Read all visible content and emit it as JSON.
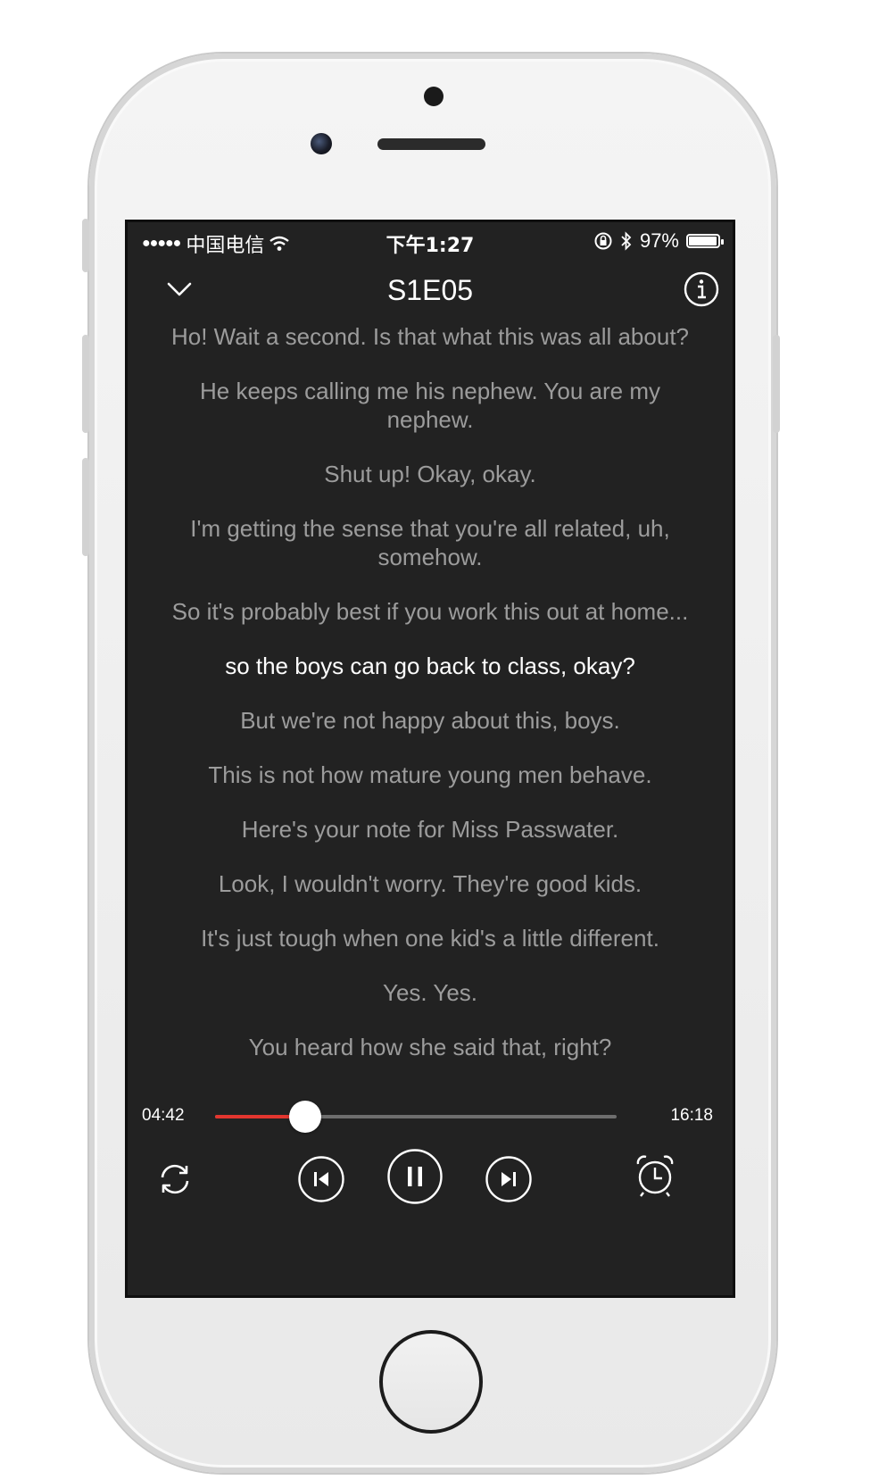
{
  "status_bar": {
    "signal_dots": "●●●●●",
    "carrier": "中国电信",
    "wifi_icon": "wifi-icon",
    "time": "下午1:27",
    "battery_percent": "97%",
    "battery_level": 0.97
  },
  "nav": {
    "title": "S1E05",
    "back_icon": "chevron-down-icon",
    "info_icon": "info-icon"
  },
  "subtitles": [
    "Ho! Wait a second. Is that what this was all about?",
    "He keeps calling me his nephew. You are my nephew.",
    "Shut up! Okay, okay.",
    "I'm getting the sense that you're all related, uh, somehow.",
    "So it's probably best if you work this out at home...",
    "so the boys can go back to class, okay?",
    "But we're not happy about this, boys.",
    "This is not how mature young men behave.",
    "Here's your note for Miss Passwater.",
    "Look, I wouldn't worry. They're good kids.",
    "It's just tough when one kid's a little different.",
    "Yes. Yes.",
    "You heard how she said that, right?"
  ],
  "active_subtitle_index": 5,
  "player": {
    "elapsed": "04:42",
    "total": "16:18",
    "progress_fraction": 0.224,
    "accent_color": "#e3362f"
  },
  "controls": {
    "loop_icon": "repeat-icon",
    "previous_icon": "skip-previous-icon",
    "pause_icon": "pause-icon",
    "next_icon": "skip-next-icon",
    "timer_icon": "alarm-clock-icon"
  }
}
